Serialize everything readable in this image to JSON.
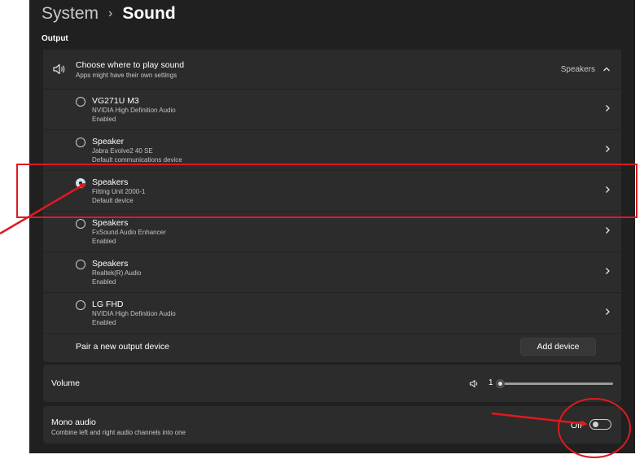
{
  "breadcrumb": {
    "parent": "System",
    "current": "Sound"
  },
  "section_label": "Output",
  "output": {
    "header": {
      "icon": "speaker-icon",
      "title": "Choose where to play sound",
      "subtitle": "Apps might have their own settings",
      "selected_value": "Speakers",
      "expanded": true
    },
    "devices": [
      {
        "name": "VG271U M3",
        "driver": "NVIDIA High Definition Audio",
        "status": "Enabled",
        "selected": false
      },
      {
        "name": "Speaker",
        "driver": "Jabra Evolve2 40 SE",
        "status": "Default communications device",
        "selected": false
      },
      {
        "name": "Speakers",
        "driver": "Fitting Unit 2000-1",
        "status": "Default device",
        "selected": true
      },
      {
        "name": "Speakers",
        "driver": "FxSound Audio Enhancer",
        "status": "Enabled",
        "selected": false
      },
      {
        "name": "Speakers",
        "driver": "Realtek(R) Audio",
        "status": "Enabled",
        "selected": false
      },
      {
        "name": "LG FHD",
        "driver": "NVIDIA High Definition Audio",
        "status": "Enabled",
        "selected": false
      }
    ],
    "pair_label": "Pair a new output device",
    "add_button": "Add device"
  },
  "volume": {
    "label": "Volume",
    "value": "1",
    "level_percent": 1,
    "icon": "volume-icon"
  },
  "mono": {
    "label": "Mono audio",
    "subtitle": "Combine left and right audio channels into one",
    "state_text": "Off",
    "on": false
  },
  "annotation": {
    "color": "#e0191f"
  }
}
